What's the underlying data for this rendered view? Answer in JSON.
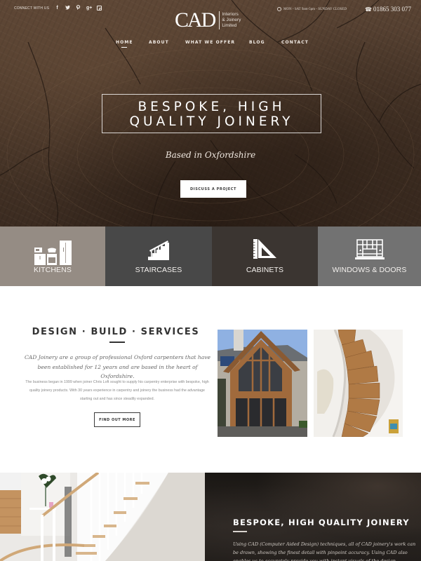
{
  "topbar": {
    "connect_label": "CONNECT WITH US",
    "social": [
      {
        "name": "facebook",
        "glyph": "f"
      },
      {
        "name": "twitter",
        "glyph": "t"
      },
      {
        "name": "pinterest",
        "glyph": "p"
      },
      {
        "name": "google-plus",
        "glyph": "g+"
      },
      {
        "name": "instagram",
        "glyph": ""
      }
    ],
    "hours": "MON - SAT 9am-5pm - SUNDAY CLOSED",
    "phone_icon": "☎",
    "phone": "01865 303 077"
  },
  "logo": {
    "mark": "CAD",
    "sub_line_1": "Interiors",
    "sub_line_2": "& Joinery",
    "sub_line_3": "Limited"
  },
  "nav": {
    "items": [
      {
        "label": "HOME",
        "active": true
      },
      {
        "label": "ABOUT",
        "active": false
      },
      {
        "label": "WHAT WE OFFER",
        "active": false
      },
      {
        "label": "BLOG",
        "active": false
      },
      {
        "label": "CONTACT",
        "active": false
      }
    ]
  },
  "hero": {
    "headline_line_1": "BESPOKE, HIGH",
    "headline_line_2": "QUALITY JOINERY",
    "tagline": "Based in Oxfordshire",
    "cta_label": "DISCUSS A PROJECT"
  },
  "services": {
    "tiles": [
      {
        "label": "KITCHENS",
        "icon": "kitchen-icon",
        "color": "#958c84"
      },
      {
        "label": "STAIRCASES",
        "icon": "staircase-icon",
        "color": "#484848"
      },
      {
        "label": "CABINETS",
        "icon": "set-square-icon",
        "color": "#3b3531"
      },
      {
        "label": "WINDOWS & DOORS",
        "icon": "window-icon",
        "color": "#727272"
      }
    ]
  },
  "about": {
    "title": "DESIGN · BUILD · SERVICES",
    "lead": "CAD Joinery are a group of professional Oxford carpenters that have been established for 12 years and are based in the heart of Oxfordshire.",
    "body": "The business began in 1999 when joiner Chris Loft sought to supply his carpentry enterprise with bespoke, high quality joinery products. With 30 years experience in carpentry and joinery the business had the advantage starting out and has since steadily expanded.",
    "button_label": "FIND OUT MORE",
    "photos": [
      {
        "alt": "Oak-framed house extension with glazed gable"
      },
      {
        "alt": "Spiral oak staircase viewed from above"
      }
    ]
  },
  "feature": {
    "photo_alt": "Curved white staircase with oak handrail",
    "title": "BESPOKE, HIGH QUALITY JOINERY",
    "text": "Using CAD (Computer Aided Design) techniques, all of CAD joinery's work can be drawn, showing the finest detail with pinpoint accuracy. Using CAD also enables us to accurately provide you with instant visuals of the design"
  }
}
